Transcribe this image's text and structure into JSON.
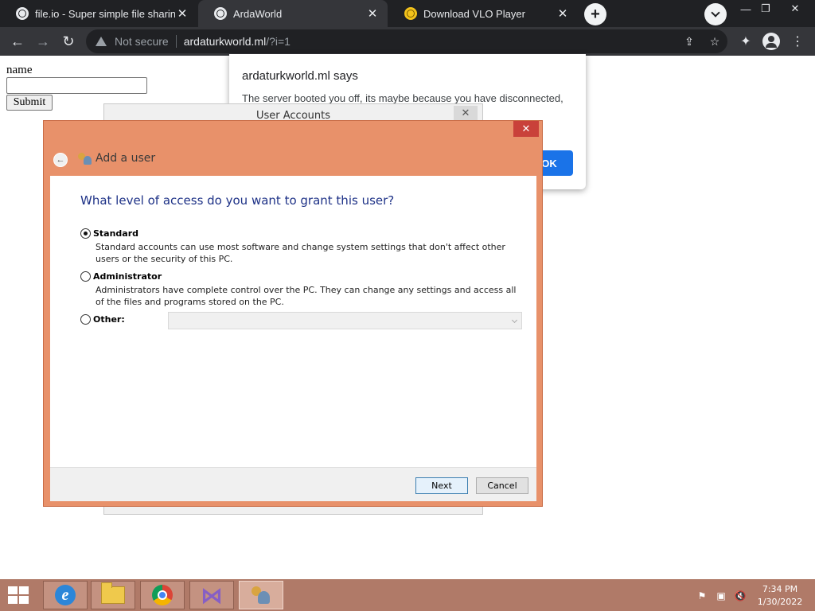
{
  "browser": {
    "tabs": [
      {
        "title": "file.io - Super simple file sharing",
        "active": false,
        "icon": "globe-icon"
      },
      {
        "title": "ArdaWorld",
        "active": true,
        "icon": "globe-icon"
      },
      {
        "title": "Download VLO Player",
        "active": false,
        "icon": "vlo-icon"
      }
    ],
    "omnibox": {
      "security": "Not secure",
      "host": "ardaturkworld.ml",
      "path": "/?i=1"
    }
  },
  "page": {
    "label": "name",
    "input_value": "",
    "submit_label": "Submit"
  },
  "alert": {
    "title": "ardaturkworld.ml says",
    "message": "The server booted you off, its maybe because you have disconnected,",
    "ok_label": "OK"
  },
  "user_accounts_window": {
    "title": "User Accounts"
  },
  "add_user_dialog": {
    "header": "Add a user",
    "question": "What level of access do you want to grant this user?",
    "options": [
      {
        "label": "Standard",
        "selected": true,
        "description": "Standard accounts can use most software and change system settings that don't affect other users or the security of this PC."
      },
      {
        "label": "Administrator",
        "selected": false,
        "description": "Administrators have complete control over the PC. They can change any settings and access all of the files and programs stored on the PC."
      },
      {
        "label": "Other:",
        "selected": false,
        "select_value": ""
      }
    ],
    "next_label": "Next",
    "cancel_label": "Cancel",
    "title_color": "#e8916a",
    "question_color": "#1e3287"
  },
  "taskbar": {
    "apps": [
      "internet-explorer-icon",
      "file-explorer-icon",
      "chrome-icon",
      "visual-studio-icon",
      "user-accounts-icon"
    ],
    "clock_time": "7:34 PM",
    "clock_date": "1/30/2022",
    "color": "#b07a68"
  }
}
